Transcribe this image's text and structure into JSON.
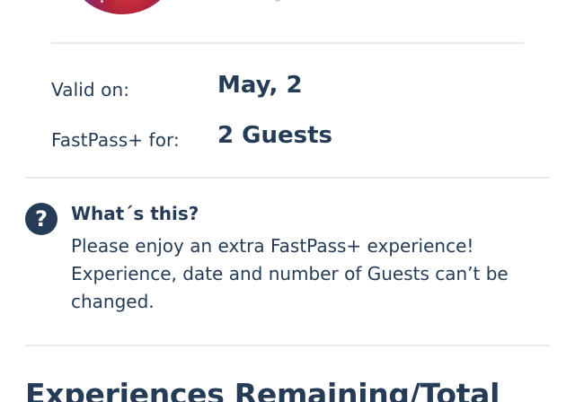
{
  "details": {
    "valid_on_label": "Valid on:",
    "valid_on_value": "May, 2",
    "fastpass_for_label": "FastPass+ for:",
    "fastpass_for_value": "2 Guests"
  },
  "help": {
    "icon": "question-circle-icon",
    "title": "What´s this?",
    "body_line1": "Please enjoy an extra FastPass+ experience!",
    "body_line2": "Experience, date and number of Guests can’t be changed."
  },
  "section": {
    "heading": "Experiences Remaining/Total"
  },
  "colors": {
    "text": "#253b56",
    "divider": "#e6ebf1",
    "background": "#ffffff"
  }
}
